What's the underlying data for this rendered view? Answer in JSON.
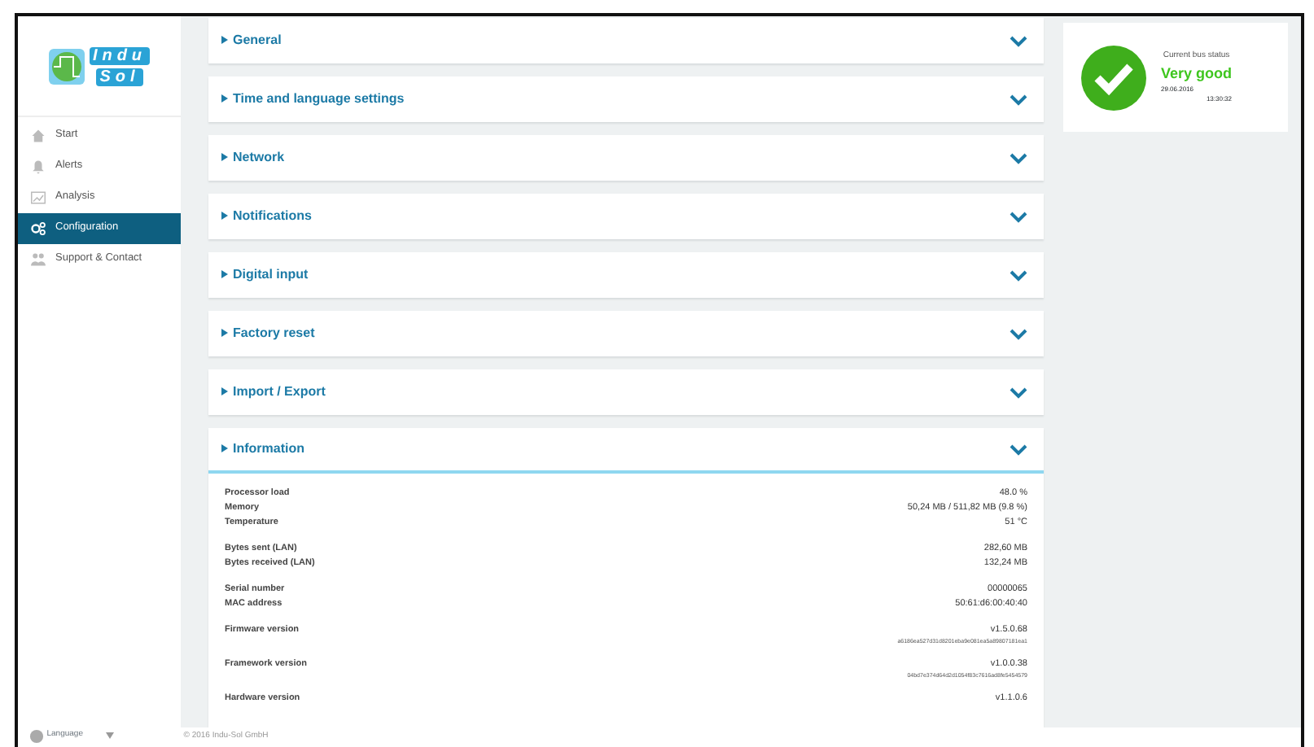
{
  "logo": {
    "top": "Indu",
    "bottom": "Sol"
  },
  "sidebar": {
    "items": [
      {
        "label": "Start",
        "selected": false
      },
      {
        "label": "Alerts",
        "selected": false
      },
      {
        "label": "Analysis",
        "selected": false
      },
      {
        "label": "Configuration",
        "selected": true
      },
      {
        "label": "Support & Contact",
        "selected": false
      }
    ]
  },
  "sections": [
    {
      "title": "General",
      "expanded": false
    },
    {
      "title": "Time and language settings",
      "expanded": false
    },
    {
      "title": "Network",
      "expanded": false
    },
    {
      "title": "Notifications",
      "expanded": false
    },
    {
      "title": "Digital input",
      "expanded": false
    },
    {
      "title": "Factory reset",
      "expanded": false
    },
    {
      "title": "Import / Export",
      "expanded": false
    },
    {
      "title": "Information",
      "expanded": true,
      "groups": [
        [
          {
            "label": "Processor load",
            "value": "48.0 %"
          },
          {
            "label": "Memory",
            "value": "50,24 MB / 511,82 MB (9.8 %)"
          },
          {
            "label": "Temperature",
            "value": "51 °C"
          }
        ],
        [
          {
            "label": "Bytes sent (LAN)",
            "value": "282,60 MB"
          },
          {
            "label": "Bytes received (LAN)",
            "value": "132,24 MB"
          }
        ],
        [
          {
            "label": "Serial number",
            "value": "00000065"
          },
          {
            "label": "MAC address",
            "value": "50:61:d6:00:40:40"
          }
        ],
        [
          {
            "label": "Firmware version",
            "value": "v1.5.0.68",
            "hash": "a6186ea527d31d8201eba9e081ea5a89807181ea1"
          }
        ],
        [
          {
            "label": "Framework version",
            "value": "v1.0.0.38",
            "hash": "04bd7e374d64d2d1054f83c7616ad8fe5454579"
          }
        ],
        [
          {
            "label": "Hardware version",
            "value": "v1.1.0.6"
          }
        ]
      ]
    }
  ],
  "bus_status": {
    "title": "Current bus status",
    "status": "Very good",
    "date": "29.06.2016",
    "time": "13:30:32"
  },
  "footer": {
    "language": "Language",
    "copyright": "© 2016 Indu-Sol GmbH"
  }
}
